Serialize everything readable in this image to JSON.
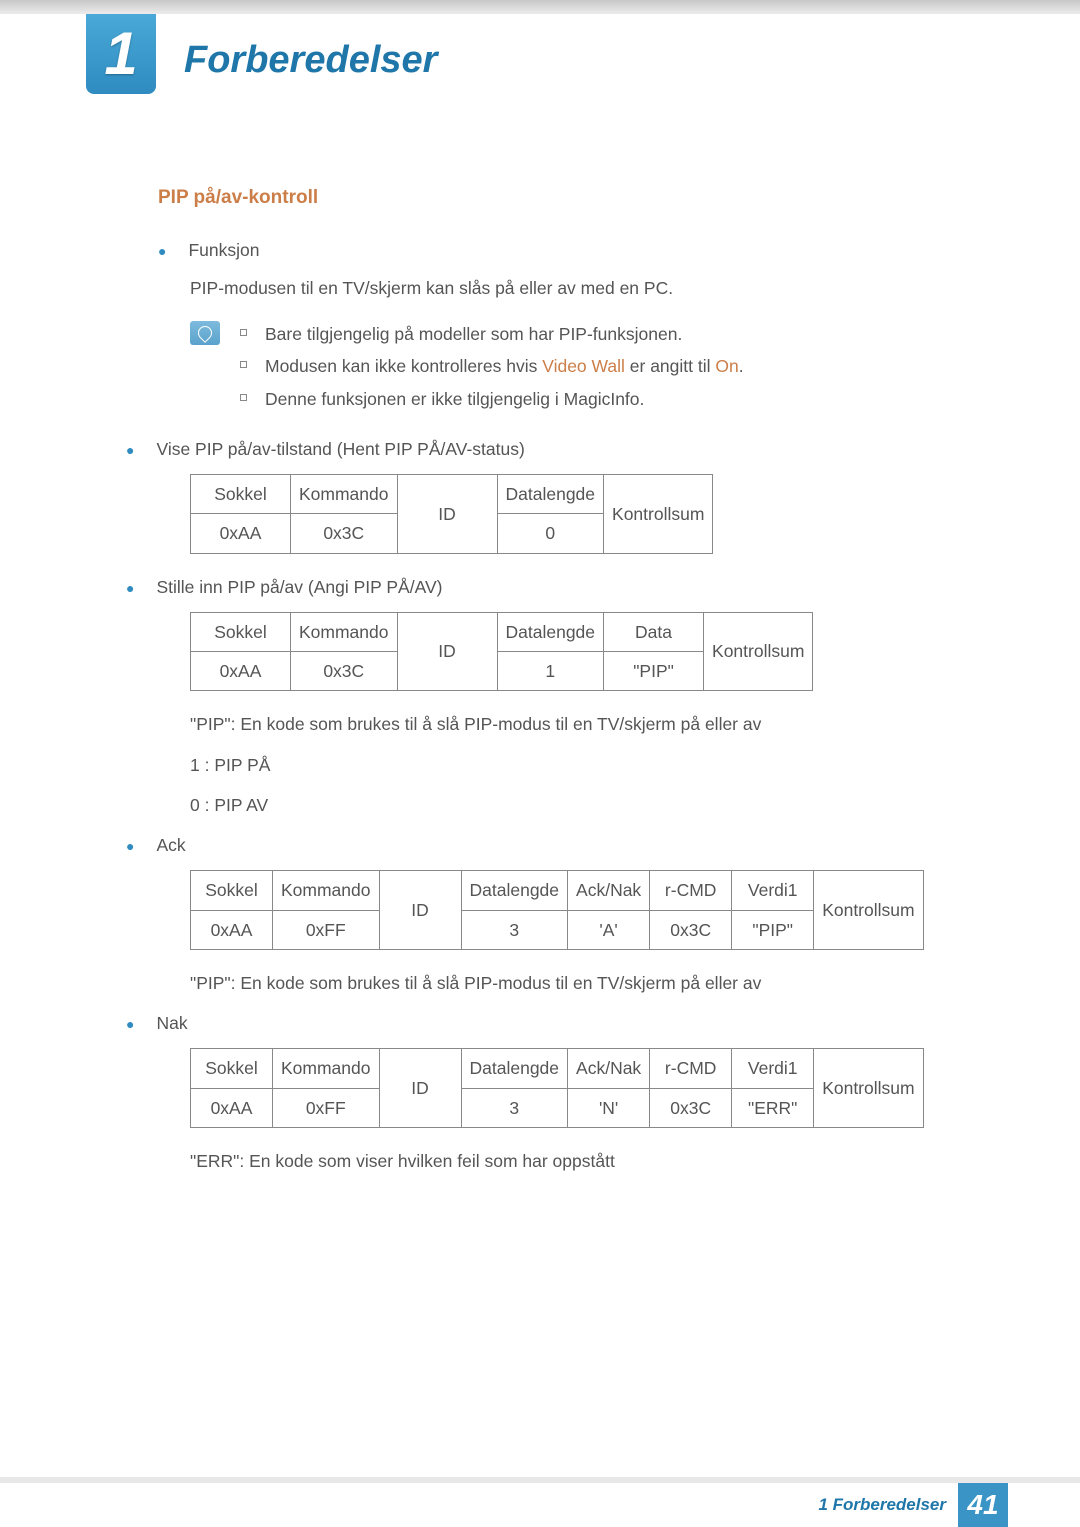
{
  "header": {
    "chapter_number": "1",
    "chapter_title": "Forberedelser"
  },
  "section": {
    "heading": "PIP på/av-kontroll",
    "funksjon_label": "Funksjon",
    "funksjon_desc": "PIP-modusen til en TV/skjerm kan slås på eller av med en PC.",
    "notes": {
      "n1": "Bare tilgjengelig på modeller som har PIP-funksjonen.",
      "n2a": "Modusen kan ikke kontrolleres hvis ",
      "n2b": "Video Wall",
      "n2c": " er angitt til ",
      "n2d": "On",
      "n2e": ".",
      "n3": "Denne funksjonen er ikke tilgjengelig i MagicInfo."
    },
    "b2": "Vise PIP på/av-tilstand (Hent PIP PÅ/AV-status)",
    "b3": "Stille inn PIP på/av (Angi PIP PÅ/AV)",
    "pip_desc": "\"PIP\": En kode som brukes til å slå PIP-modus til en TV/skjerm på eller av",
    "pip_on": "1 : PIP PÅ",
    "pip_off": "0 : PIP AV",
    "ack_label": "Ack",
    "nak_label": "Nak",
    "err_desc": "\"ERR\": En kode som viser hvilken feil som har oppstått"
  },
  "tables": {
    "t1": {
      "h_sokkel": "Sokkel",
      "h_kommando": "Kommando",
      "h_id": "ID",
      "h_datalengde": "Datalengde",
      "h_kontrollsum": "Kontrollsum",
      "v_sokkel": "0xAA",
      "v_kommando": "0x3C",
      "v_datalengde": "0"
    },
    "t2": {
      "h_sokkel": "Sokkel",
      "h_kommando": "Kommando",
      "h_id": "ID",
      "h_datalengde": "Datalengde",
      "h_data": "Data",
      "h_kontrollsum": "Kontrollsum",
      "v_sokkel": "0xAA",
      "v_kommando": "0x3C",
      "v_datalengde": "1",
      "v_data": "\"PIP\""
    },
    "t3": {
      "h_sokkel": "Sokkel",
      "h_kommando": "Kommando",
      "h_id": "ID",
      "h_datalengde": "Datalengde",
      "h_acknak": "Ack/Nak",
      "h_rcmd": "r-CMD",
      "h_verdi1": "Verdi1",
      "h_kontrollsum": "Kontrollsum",
      "v_sokkel": "0xAA",
      "v_kommando": "0xFF",
      "v_datalengde": "3",
      "v_acknak": "'A'",
      "v_rcmd": "0x3C",
      "v_verdi1": "\"PIP\""
    },
    "t4": {
      "h_sokkel": "Sokkel",
      "h_kommando": "Kommando",
      "h_id": "ID",
      "h_datalengde": "Datalengde",
      "h_acknak": "Ack/Nak",
      "h_rcmd": "r-CMD",
      "h_verdi1": "Verdi1",
      "h_kontrollsum": "Kontrollsum",
      "v_sokkel": "0xAA",
      "v_kommando": "0xFF",
      "v_datalengde": "3",
      "v_acknak": "'N'",
      "v_rcmd": "0x3C",
      "v_verdi1": "\"ERR\""
    }
  },
  "footer": {
    "text": "1 Forberedelser",
    "page": "41"
  }
}
